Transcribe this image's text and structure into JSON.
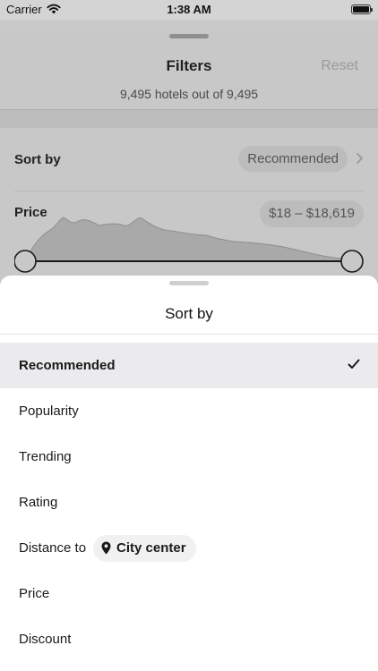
{
  "status_bar": {
    "carrier": "Carrier",
    "time": "1:38 AM"
  },
  "filters": {
    "title": "Filters",
    "reset_label": "Reset",
    "hotel_count": "9,495 hotels out of 9,495",
    "sort_by_label": "Sort by",
    "sort_by_value": "Recommended",
    "price_label": "Price",
    "price_range": "$18 – $18,619"
  },
  "sort_sheet": {
    "title": "Sort by",
    "options": [
      "Recommended",
      "Popularity",
      "Trending",
      "Rating",
      "Distance to",
      "Price",
      "Discount"
    ],
    "selected_index": 0,
    "distance_chip": "City center"
  },
  "icons": {
    "wifi": "wifi-icon",
    "battery": "battery-icon",
    "chevron": "chevron-right-icon",
    "check": "checkmark-icon",
    "pin": "location-pin-icon"
  },
  "colors": {
    "selected_row": "#ebebed",
    "dim_overlay": "#c8c8c8",
    "sheet": "#ffffff"
  }
}
